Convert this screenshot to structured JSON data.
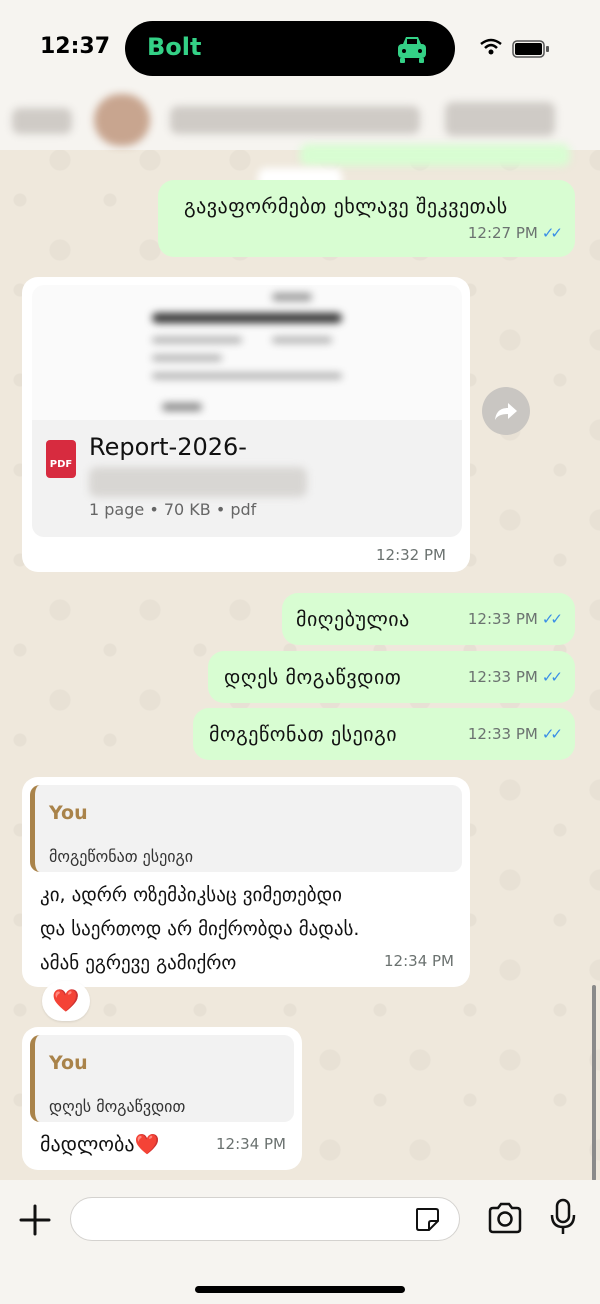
{
  "status_bar": {
    "time": "12:37",
    "app_logo": "Bolt"
  },
  "messages": [
    {
      "id": "m1",
      "direction": "out",
      "text": "გავაფორმებთ ეხლავე შეკვეთას",
      "time": "12:27 PM",
      "status": "read"
    },
    {
      "id": "m2",
      "direction": "in",
      "type": "document",
      "file_name": "Report-2026-",
      "file_details": "1 page • 70 KB • pdf",
      "time": "12:32 PM"
    },
    {
      "id": "m3",
      "direction": "out",
      "text": "მიღებულია",
      "time": "12:33 PM",
      "status": "read"
    },
    {
      "id": "m4",
      "direction": "out",
      "text": "დღეს მოგაწვდით",
      "time": "12:33 PM",
      "status": "read"
    },
    {
      "id": "m5",
      "direction": "out",
      "text": "მოგეწონათ ესეიგი",
      "time": "12:33 PM",
      "status": "read"
    },
    {
      "id": "m6",
      "direction": "in",
      "quote_author": "You",
      "quote_text": "მოგეწონათ ესეიგი",
      "text_lines": [
        "კი, ადრრ ოზემპიკსაც ვიმეთებდი",
        "და საერთოდ არ მიქრობდა მადას.",
        "ამან ეგრევე გამიქრო"
      ],
      "time": "12:34 PM",
      "reaction": "❤️"
    },
    {
      "id": "m7",
      "direction": "in",
      "quote_author": "You",
      "quote_text": "დღეს მოგაწვდით",
      "text": "მადლობა❤️",
      "time": "12:34 PM"
    }
  ],
  "input": {
    "placeholder": "",
    "value": ""
  },
  "icons": {
    "car": "car-icon",
    "wifi": "wifi-icon",
    "battery": "battery-icon",
    "forward": "forward-icon",
    "plus": "plus-icon",
    "sticker": "sticker-icon",
    "camera": "camera-icon",
    "mic": "mic-icon",
    "pdf": "pdf-icon"
  },
  "colors": {
    "outgoing_bubble": "#d8fdd2",
    "incoming_bubble": "#ffffff",
    "read_ticks": "#3a8ee6",
    "quote_accent": "#a9834a",
    "bolt_green": "#34d186"
  }
}
